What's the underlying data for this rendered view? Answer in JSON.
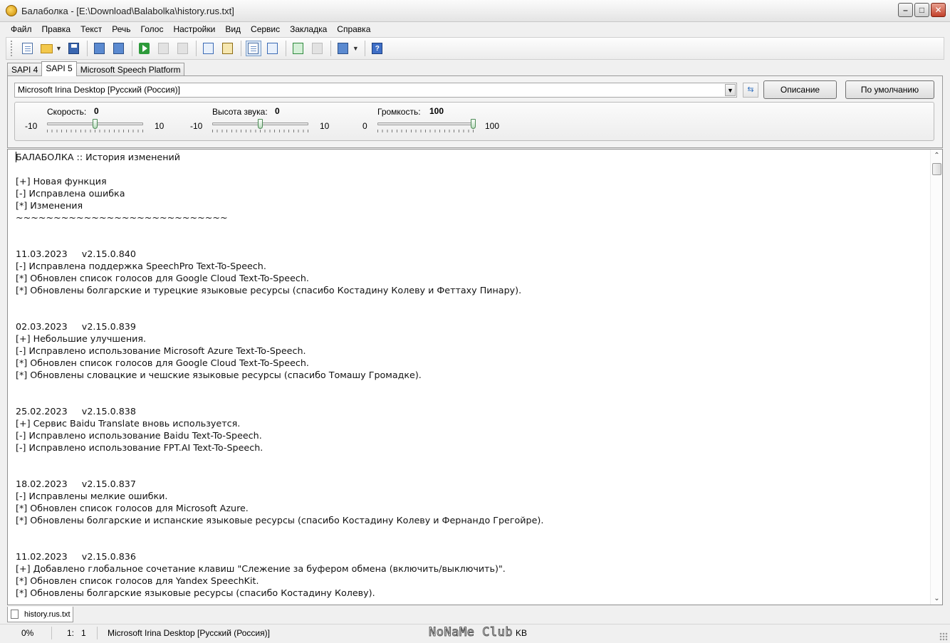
{
  "window": {
    "title": "Балаболка - [E:\\Download\\Balabolka\\history.rus.txt]",
    "controls": [
      "minimize",
      "maximize",
      "close"
    ]
  },
  "menu": [
    "Файл",
    "Правка",
    "Текст",
    "Речь",
    "Голос",
    "Настройки",
    "Вид",
    "Сервис",
    "Закладка",
    "Справка"
  ],
  "toolbar": {
    "icons": [
      "new-document-icon",
      "open-folder-icon",
      "save-icon",
      "save-audio-icon",
      "batch-convert-icon",
      "play-icon",
      "pause-icon",
      "stop-icon",
      "clipboard-read-icon",
      "bookmark-icon",
      "properties-icon",
      "dictionary-icon",
      "spell-check-icon",
      "split-icon",
      "convert-icon",
      "help-icon"
    ]
  },
  "tabs": [
    "SAPI 4",
    "SAPI 5",
    "Microsoft Speech Platform"
  ],
  "selected_tab": "SAPI 5",
  "voice": {
    "selected": "Microsoft Irina Desktop [Русский (Россия)]",
    "describe_button": "Описание",
    "default_button": "По умолчанию"
  },
  "sliders": {
    "rate": {
      "label": "Скорость:",
      "value": "0",
      "min": "-10",
      "max": "10",
      "fraction": 0.5
    },
    "pitch": {
      "label": "Высота звука:",
      "value": "0",
      "min": "-10",
      "max": "10",
      "fraction": 0.5
    },
    "volume": {
      "label": "Громкость:",
      "value": "100",
      "min": "0",
      "max": "100",
      "fraction": 1.0
    }
  },
  "editor": {
    "lines": [
      "БАЛАБОЛКА :: История изменений",
      "",
      "[+] Новая функция",
      "[-] Исправлена ошибка",
      "[*] Изменения",
      "~~~~~~~~~~~~~~~~~~~~~~~~~~~~",
      "",
      "",
      "11.03.2023     v2.15.0.840",
      "[-] Исправлена поддержка SpeechPro Text-To-Speech.",
      "[*] Обновлен список голосов для Google Cloud Text-To-Speech.",
      "[*] Обновлены болгарские и турецкие языковые ресурсы (спасибо Костадину Колеву и Феттаху Пинару).",
      "",
      "",
      "02.03.2023     v2.15.0.839",
      "[+] Небольшие улучшения.",
      "[-] Исправлено использование Microsoft Azure Text-To-Speech.",
      "[*] Обновлен список голосов для Google Cloud Text-To-Speech.",
      "[*] Обновлены словацкие и чешские языковые ресурсы (спасибо Томашу Громадке).",
      "",
      "",
      "25.02.2023     v2.15.0.838",
      "[+] Сервис Baidu Translate вновь используется.",
      "[-] Исправлено использование Baidu Text-To-Speech.",
      "[-] Исправлено использование FPT.AI Text-To-Speech.",
      "",
      "",
      "18.02.2023     v2.15.0.837",
      "[-] Исправлены мелкие ошибки.",
      "[*] Обновлен список голосов для Microsoft Azure.",
      "[*] Обновлены болгарские и испанские языковые ресурсы (спасибо Костадину Колеву и Фернандо Грегойре).",
      "",
      "",
      "11.02.2023     v2.15.0.836",
      "[+] Добавлено глобальное сочетание клавиш \"Слежение за буфером обмена (включить/выключить)\".",
      "[*] Обновлен список голосов для Yandex SpeechKit.",
      "[*] Обновлены болгарские языковые ресурсы (спасибо Костадину Колеву)."
    ]
  },
  "document_tab": "history.rus.txt",
  "status": {
    "percent": "0%",
    "position": "1:   1",
    "voice": "Microsoft Irina Desktop [Русский (Россия)]",
    "size_suffix": "KB",
    "watermark": "NoNaMe Club"
  }
}
